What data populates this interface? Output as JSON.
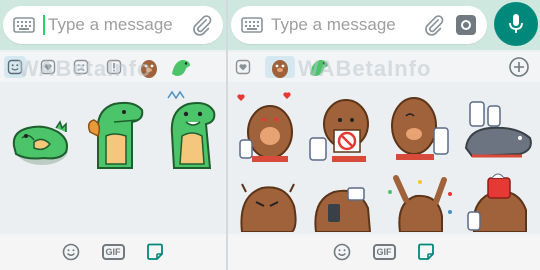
{
  "left_panel": {
    "input": {
      "placeholder": "Type a message"
    },
    "watermark": "WABetaInfo",
    "tabs": [
      {
        "icon": "emoji-smile-icon",
        "active": true
      },
      {
        "icon": "heart-icon",
        "active": false
      },
      {
        "icon": "sad-face-icon",
        "active": false
      },
      {
        "icon": "exclamation-icon",
        "active": false
      }
    ],
    "bottom": {
      "gif_label": "GIF"
    }
  },
  "right_panel": {
    "input": {
      "placeholder": "Type a message"
    },
    "watermark": "WABetaInfo",
    "tabs": [
      {
        "icon": "heart-icon",
        "active": false
      }
    ],
    "bottom": {
      "gif_label": "GIF"
    }
  },
  "colors": {
    "accent": "#00897b",
    "topbar": "#cfe8df",
    "dino_green": "#4bc46a",
    "dino_belly": "#f4c77c",
    "bear_brown": "#a0623a"
  }
}
